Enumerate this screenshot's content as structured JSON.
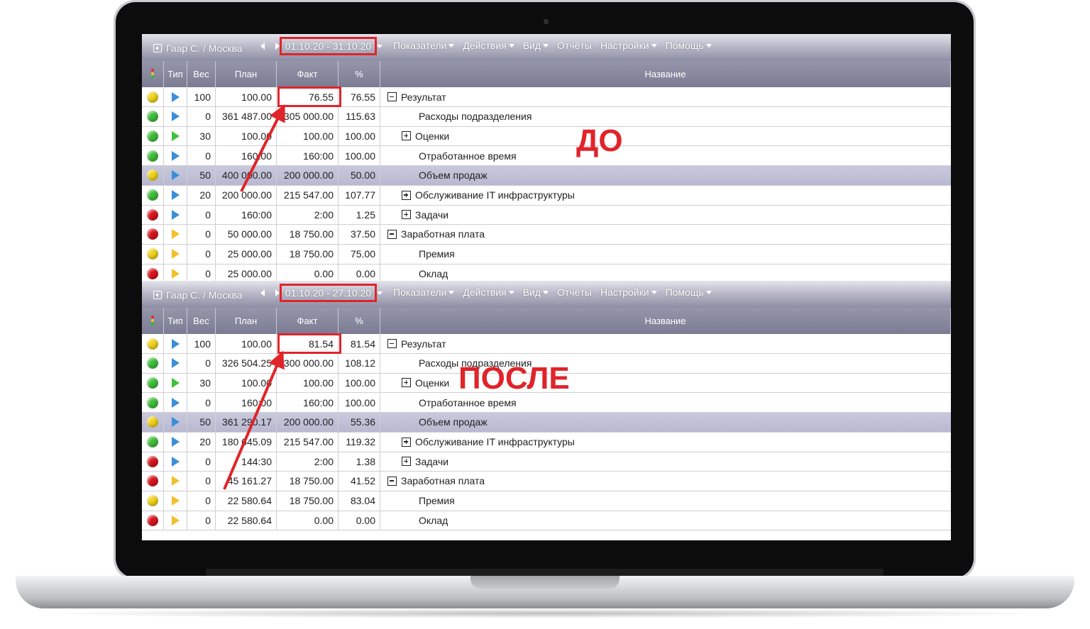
{
  "colors": {
    "accent_red": "#e0242a",
    "status_yellow": "#f1d41c",
    "status_green": "#3fbf3a",
    "status_red": "#d8161c",
    "type_blue": "#3a8fd8",
    "type_green": "#3fc23a",
    "type_orange": "#f2c02a"
  },
  "columns": {
    "status": "",
    "type": "Тип",
    "weight": "Вес",
    "plan": "План",
    "fact": "Факт",
    "percent": "%",
    "name": "Название"
  },
  "menu": [
    "Показатели",
    "Действия",
    "Вид",
    "Отчёты",
    "Настройки",
    "Помощь"
  ],
  "panels": [
    {
      "user": "Гаар С. / Москва",
      "period": "01.10.20 - 31.10.20",
      "label": "ДО",
      "selected_row": 4,
      "rows": [
        {
          "status": "yellow",
          "type": "blue",
          "weight": "100",
          "plan": "100.00",
          "fact": "76.55",
          "percent": "76.55",
          "name": "Результат",
          "tree": "minus",
          "indent": 0
        },
        {
          "status": "green",
          "type": "blue",
          "weight": "0",
          "plan": "361 487.00",
          "fact": "305 000.00",
          "percent": "115.63",
          "name": "Расходы подразделения",
          "tree": "none",
          "indent": 2
        },
        {
          "status": "green",
          "type": "green",
          "weight": "30",
          "plan": "100.00",
          "fact": "100.00",
          "percent": "100.00",
          "name": "Оценки",
          "tree": "plus",
          "indent": 1
        },
        {
          "status": "green",
          "type": "blue",
          "weight": "0",
          "plan": "160:00",
          "fact": "160:00",
          "percent": "100.00",
          "name": "Отработанное время",
          "tree": "none",
          "indent": 2
        },
        {
          "status": "yellow",
          "type": "blue",
          "weight": "50",
          "plan": "400 000.00",
          "fact": "200 000.00",
          "percent": "50.00",
          "name": "Объем продаж",
          "tree": "none",
          "indent": 2
        },
        {
          "status": "green",
          "type": "blue",
          "weight": "20",
          "plan": "200 000.00",
          "fact": "215 547.00",
          "percent": "107.77",
          "name": "Обслуживание IT инфраструктуры",
          "tree": "plus",
          "indent": 1
        },
        {
          "status": "red",
          "type": "blue",
          "weight": "0",
          "plan": "160:00",
          "fact": "2:00",
          "percent": "1.25",
          "name": "Задачи",
          "tree": "plus",
          "indent": 1
        },
        {
          "status": "red",
          "type": "orange",
          "weight": "0",
          "plan": "50 000.00",
          "fact": "18 750.00",
          "percent": "37.50",
          "name": "Заработная плата",
          "tree": "minus",
          "indent": 0
        },
        {
          "status": "yellow",
          "type": "orange",
          "weight": "0",
          "plan": "25 000.00",
          "fact": "18 750.00",
          "percent": "75.00",
          "name": "Премия",
          "tree": "none",
          "indent": 2
        },
        {
          "status": "red",
          "type": "orange",
          "weight": "0",
          "plan": "25 000.00",
          "fact": "0.00",
          "percent": "0.00",
          "name": "Оклад",
          "tree": "none",
          "indent": 2
        }
      ]
    },
    {
      "user": "Гаар С. / Москва",
      "period": "01.10.20 - 27.10.20",
      "label": "ПОСЛЕ",
      "selected_row": 4,
      "rows": [
        {
          "status": "yellow",
          "type": "blue",
          "weight": "100",
          "plan": "100.00",
          "fact": "81.54",
          "percent": "81.54",
          "name": "Результат",
          "tree": "minus",
          "indent": 0
        },
        {
          "status": "green",
          "type": "blue",
          "weight": "0",
          "plan": "326 504.25",
          "fact": "300 000.00",
          "percent": "108.12",
          "name": "Расходы подразделения",
          "tree": "none",
          "indent": 2
        },
        {
          "status": "green",
          "type": "green",
          "weight": "30",
          "plan": "100.00",
          "fact": "100.00",
          "percent": "100.00",
          "name": "Оценки",
          "tree": "plus",
          "indent": 1
        },
        {
          "status": "green",
          "type": "blue",
          "weight": "0",
          "plan": "160:00",
          "fact": "160:00",
          "percent": "100.00",
          "name": "Отработанное время",
          "tree": "none",
          "indent": 2
        },
        {
          "status": "yellow",
          "type": "blue",
          "weight": "50",
          "plan": "361 290.17",
          "fact": "200 000.00",
          "percent": "55.36",
          "name": "Объем продаж",
          "tree": "none",
          "indent": 2
        },
        {
          "status": "green",
          "type": "blue",
          "weight": "20",
          "plan": "180 645.09",
          "fact": "215 547.00",
          "percent": "119.32",
          "name": "Обслуживание IT инфраструктуры",
          "tree": "plus",
          "indent": 1
        },
        {
          "status": "red",
          "type": "blue",
          "weight": "0",
          "plan": "144:30",
          "fact": "2:00",
          "percent": "1.38",
          "name": "Задачи",
          "tree": "plus",
          "indent": 1
        },
        {
          "status": "red",
          "type": "orange",
          "weight": "0",
          "plan": "45 161.27",
          "fact": "18 750.00",
          "percent": "41.52",
          "name": "Заработная плата",
          "tree": "minus",
          "indent": 0
        },
        {
          "status": "yellow",
          "type": "orange",
          "weight": "0",
          "plan": "22 580.64",
          "fact": "18 750.00",
          "percent": "83.04",
          "name": "Премия",
          "tree": "none",
          "indent": 2
        },
        {
          "status": "red",
          "type": "orange",
          "weight": "0",
          "plan": "22 580.64",
          "fact": "0.00",
          "percent": "0.00",
          "name": "Оклад",
          "tree": "none",
          "indent": 2
        }
      ]
    }
  ]
}
